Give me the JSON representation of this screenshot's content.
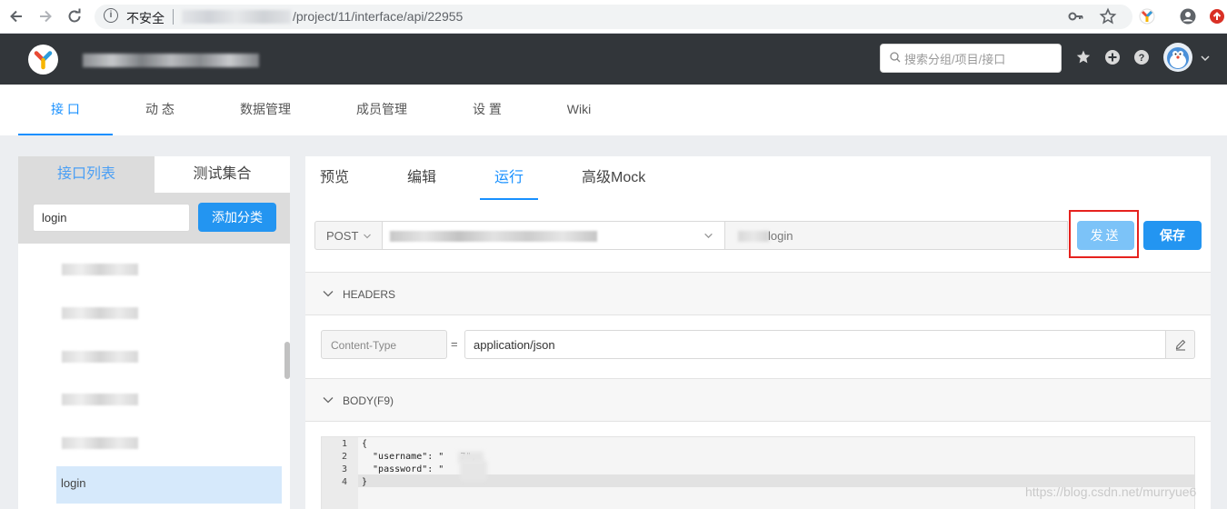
{
  "browser": {
    "insecure_label": "不安全",
    "url_path": "/project/11/interface/api/22955"
  },
  "header": {
    "search_placeholder": "搜索分组/项目/接口"
  },
  "nav": {
    "tabs": [
      {
        "label": "接 口",
        "active": true
      },
      {
        "label": "动 态",
        "active": false
      },
      {
        "label": "数据管理",
        "active": false
      },
      {
        "label": "成员管理",
        "active": false
      },
      {
        "label": "设 置",
        "active": false
      },
      {
        "label": "Wiki",
        "active": false
      }
    ]
  },
  "sidebar": {
    "tab_list": "接口列表",
    "tab_collection": "测试集合",
    "filter_value": "login",
    "add_category": "添加分类",
    "selected_item": "login"
  },
  "main": {
    "tabs": [
      {
        "label": "预览",
        "active": false
      },
      {
        "label": "编辑",
        "active": false
      },
      {
        "label": "运行",
        "active": true
      },
      {
        "label": "高级Mock",
        "active": false
      }
    ],
    "method": "POST",
    "path_suffix": "login",
    "send_label": "发送",
    "save_label": "保存",
    "headers_title": "HEADERS",
    "header_key_placeholder": "Content-Type",
    "header_equals": "=",
    "header_value": "application/json",
    "body_title": "BODY(F9)",
    "code": {
      "line_numbers": [
        "1",
        "2",
        "3",
        "4"
      ],
      "line1": "{",
      "line2": "  \"username\": \"   7\",",
      "line3": "  \"password\": \"     a\"",
      "line4": "}"
    }
  },
  "watermark": "https://blog.csdn.net/murryue6",
  "colors": {
    "accent": "#1890ff",
    "primary_button": "#2395f1",
    "header_bg": "#32363a",
    "highlight_border": "#e6221e"
  }
}
